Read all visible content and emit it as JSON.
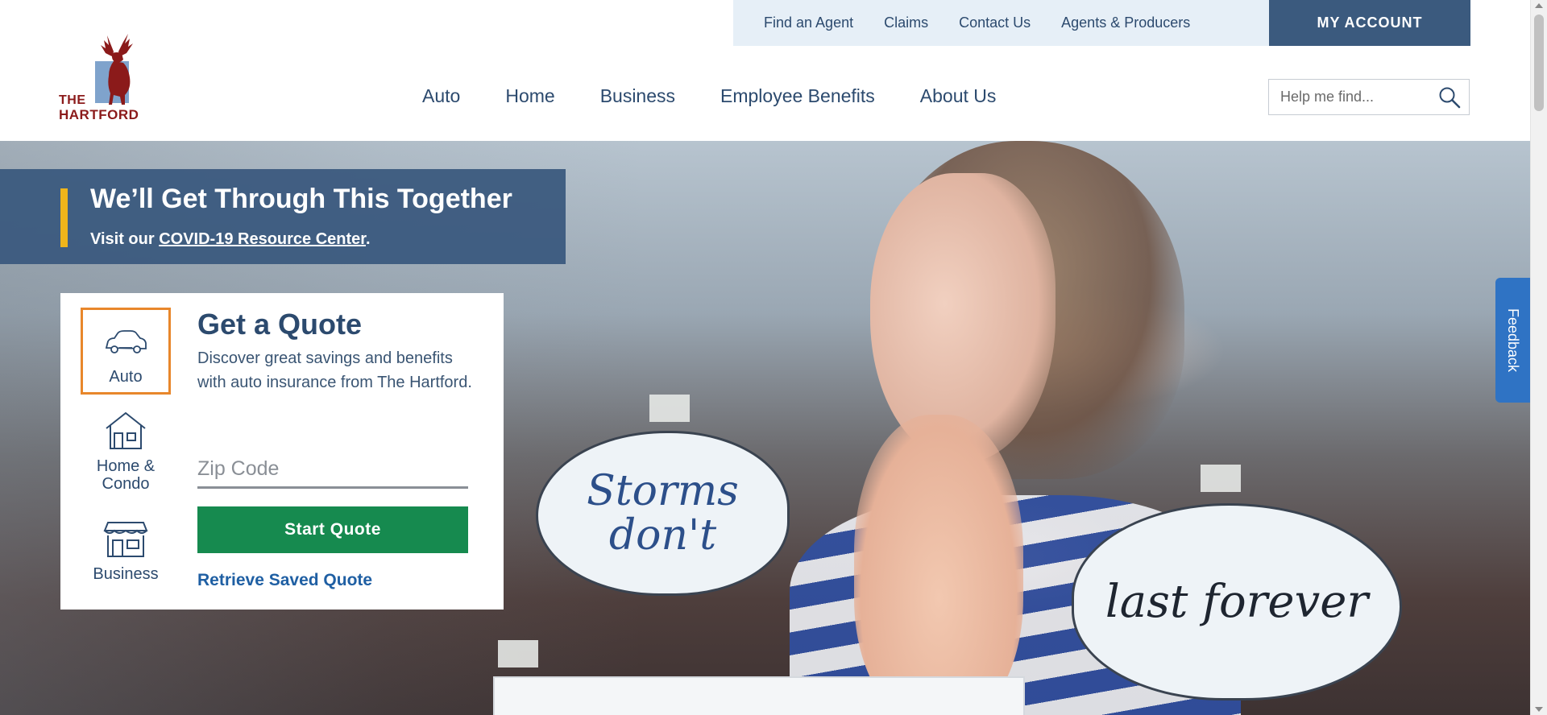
{
  "logo": {
    "line1": "THE",
    "line2": "HARTFORD",
    "brand_color": "#8b1a1a"
  },
  "utility_nav": {
    "links": [
      "Find an Agent",
      "Claims",
      "Contact Us",
      "Agents & Producers"
    ],
    "account_button": "MY ACCOUNT"
  },
  "main_nav": {
    "items": [
      "Auto",
      "Home",
      "Business",
      "Employee Benefits",
      "About Us"
    ]
  },
  "search": {
    "placeholder": "Help me find...",
    "icon": "search-icon"
  },
  "banner": {
    "title": "We’ll Get Through This Together",
    "prefix": "Visit our ",
    "link": "COVID-19 Resource Center",
    "suffix": ".",
    "accent": "#f0b51b"
  },
  "quote": {
    "tabs": [
      {
        "label": "Auto",
        "icon": "car-icon",
        "selected": true
      },
      {
        "label": "Home & Condo",
        "icon": "house-icon",
        "selected": false
      },
      {
        "label": "Business",
        "icon": "storefront-icon",
        "selected": false
      }
    ],
    "title": "Get a Quote",
    "description": "Discover great savings and benefits with auto insurance from The Hartford.",
    "zip_placeholder": "Zip Code",
    "start_button": "Start Quote",
    "retrieve_link": "Retrieve Saved Quote",
    "button_color": "#168a4f",
    "selected_border": "#e8872b"
  },
  "hero": {
    "cloud1_text": "Storms don't",
    "cloud2_text": "last forever"
  },
  "feedback": {
    "label": "Feedback"
  },
  "colors": {
    "primary": "#3b5a7e",
    "utility_bg": "#e6eff7"
  }
}
